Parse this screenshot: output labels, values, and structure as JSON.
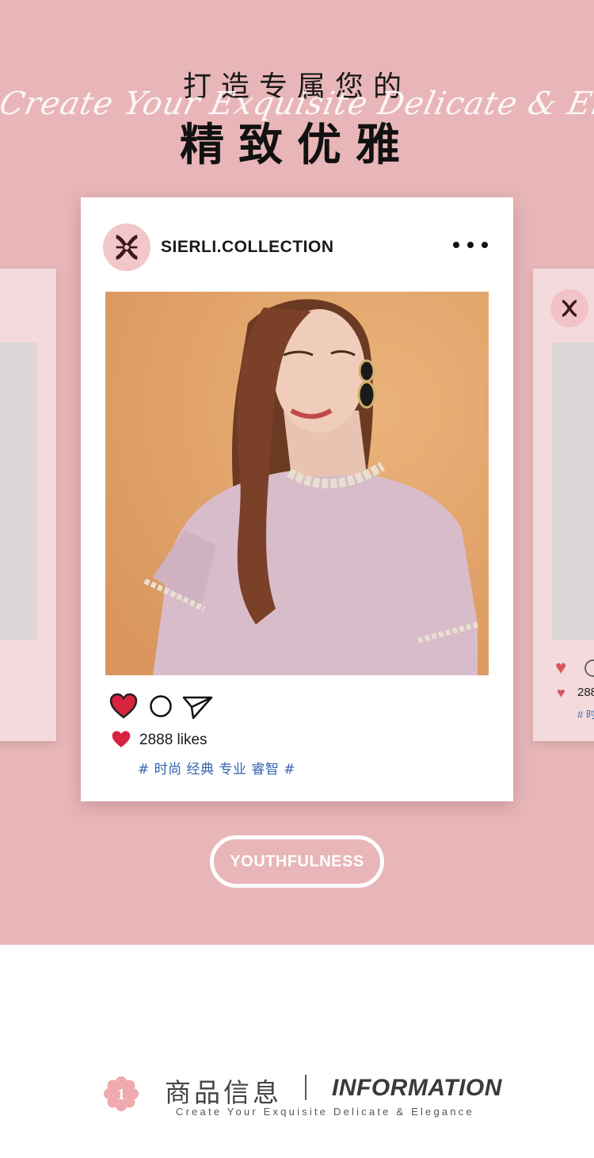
{
  "hero": {
    "title_line1": "打造专属您的",
    "script_text": "Create Your Exquisite Delicate & Elegance",
    "title_line2": "精致优雅"
  },
  "post": {
    "account": "SIERLI.COLLECTION",
    "likes": "2888 likes",
    "tags": "# 时尚 经典 专业 睿智 #",
    "heart_color": "#d8233f"
  },
  "side_card": {
    "likes_partial": "288",
    "tag_partial": "# 时"
  },
  "button": {
    "label": "YOUTHFULNESS"
  },
  "info": {
    "number": "1",
    "title_cn": "商品信息",
    "title_en": "INFORMATION",
    "subtitle": "Create Your Exquisite Delicate & Elegance"
  },
  "colors": {
    "background_pink": "#e8b6b8",
    "tag_blue": "#3562ad"
  }
}
